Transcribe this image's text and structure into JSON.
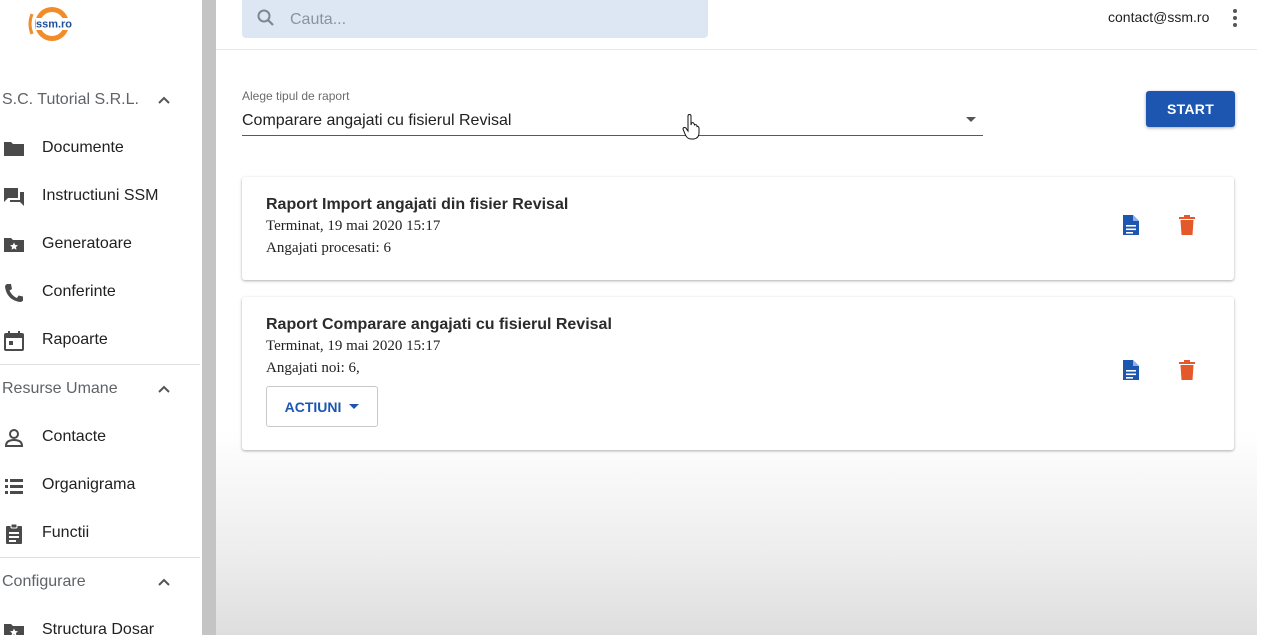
{
  "brand": {
    "logo_text": "ssm.ro"
  },
  "sidebar": {
    "sections": [
      {
        "title": "S.C. Tutorial S.R.L.",
        "items": [
          {
            "label": "Documente",
            "icon": "folder-icon"
          },
          {
            "label": "Instructiuni SSM",
            "icon": "forum-icon"
          },
          {
            "label": "Generatoare",
            "icon": "folder-star-icon"
          },
          {
            "label": "Conferinte",
            "icon": "phone-icon"
          },
          {
            "label": "Rapoarte",
            "icon": "calendar-icon"
          }
        ]
      },
      {
        "title": "Resurse Umane",
        "items": [
          {
            "label": "Contacte",
            "icon": "person-icon"
          },
          {
            "label": "Organigrama",
            "icon": "list-icon"
          },
          {
            "label": "Functii",
            "icon": "clipboard-icon"
          }
        ]
      },
      {
        "title": "Configurare",
        "items": [
          {
            "label": "Structura Dosar",
            "icon": "folder-star-icon"
          }
        ]
      }
    ]
  },
  "topbar": {
    "search_placeholder": "Cauta...",
    "user_email": "contact@ssm.ro"
  },
  "report_select": {
    "label": "Alege tipul de raport",
    "value": "Comparare angajati cu fisierul Revisal"
  },
  "start_button": "START",
  "reports": [
    {
      "title": "Raport Import angajati din fisier Revisal",
      "status": "Terminat, 19 mai 2020 15:17",
      "detail": "Angajati procesati: 6"
    },
    {
      "title": "Raport Comparare angajati cu fisierul Revisal",
      "status": "Terminat, 19 mai 2020 15:17",
      "detail": "Angajati noi: 6,",
      "actions_label": "ACTIUNI"
    }
  ],
  "colors": {
    "primary": "#1d56b0",
    "danger": "#e5582a",
    "logo_orange": "#f28c28"
  }
}
